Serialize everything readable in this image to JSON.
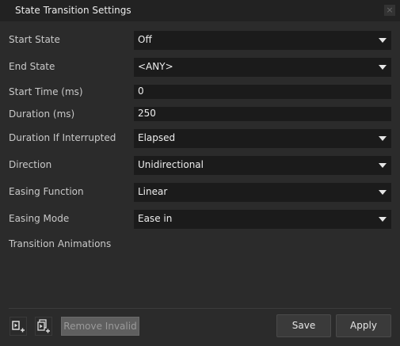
{
  "window": {
    "title": "State Transition Settings",
    "close_glyph": "×"
  },
  "fields": {
    "start_state": {
      "label": "Start State",
      "value": "Off"
    },
    "end_state": {
      "label": "End State",
      "value": "<ANY>"
    },
    "start_time": {
      "label": "Start Time (ms)",
      "value": "0"
    },
    "duration": {
      "label": "Duration (ms)",
      "value": "250"
    },
    "duration_if_interrupted": {
      "label": "Duration If Interrupted",
      "value": "Elapsed"
    },
    "direction": {
      "label": "Direction",
      "value": "Unidirectional"
    },
    "easing_function": {
      "label": "Easing Function",
      "value": "Linear"
    },
    "easing_mode": {
      "label": "Easing Mode",
      "value": "Ease in"
    }
  },
  "transition_animations": {
    "label": "Transition Animations"
  },
  "footer": {
    "remove_invalid_label": "Remove Invalid",
    "save_label": "Save",
    "apply_label": "Apply"
  },
  "icons": {
    "add_animation": "add-animation-icon",
    "add_animations": "add-multiple-animations-icon",
    "close": "close-icon",
    "dropdown": "chevron-down-icon"
  }
}
